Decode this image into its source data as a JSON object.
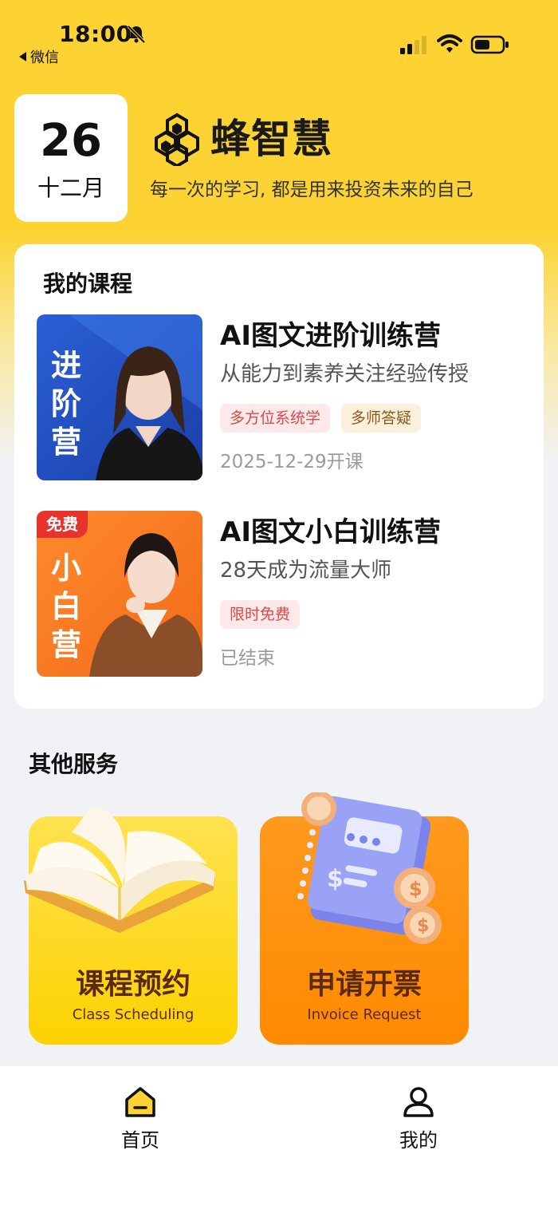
{
  "status_bar": {
    "time": "18:00",
    "back_app": "微信"
  },
  "header": {
    "date_day": "26",
    "date_month": "十二月",
    "brand_name": "蜂智慧",
    "slogan": "每一次的学习, 都是用来投资未来的自己"
  },
  "courses": {
    "section_title": "我的课程",
    "items": [
      {
        "cover_text": "进阶营",
        "title": "AI图文进阶训练营",
        "subtitle": "从能力到素养关注经验传授",
        "tags": [
          "多方位系统学",
          "多师答疑"
        ],
        "status": "2025-12-29开课"
      },
      {
        "cover_badge": "免费",
        "cover_text": "小白营",
        "title": "AI图文小白训练营",
        "subtitle": "28天成为流量大师",
        "tags": [
          "限时免费"
        ],
        "status": "已结束"
      }
    ]
  },
  "services": {
    "section_title": "其他服务",
    "items": [
      {
        "title": "课程预约",
        "subtitle": "Class Scheduling",
        "icon": "open-book-icon"
      },
      {
        "title": "申请开票",
        "subtitle": "Invoice Request",
        "icon": "invoice-book-icon"
      }
    ]
  },
  "tab_bar": {
    "items": [
      {
        "label": "首页",
        "icon": "home-icon",
        "active": true
      },
      {
        "label": "我的",
        "icon": "user-icon",
        "active": false
      }
    ]
  },
  "colors": {
    "brand_yellow": "#fcd333",
    "tag_red": "#d94a4a",
    "tag_orange": "#8a5a1c",
    "tile_yellow": "#fcd200",
    "tile_orange": "#ff8a00"
  }
}
